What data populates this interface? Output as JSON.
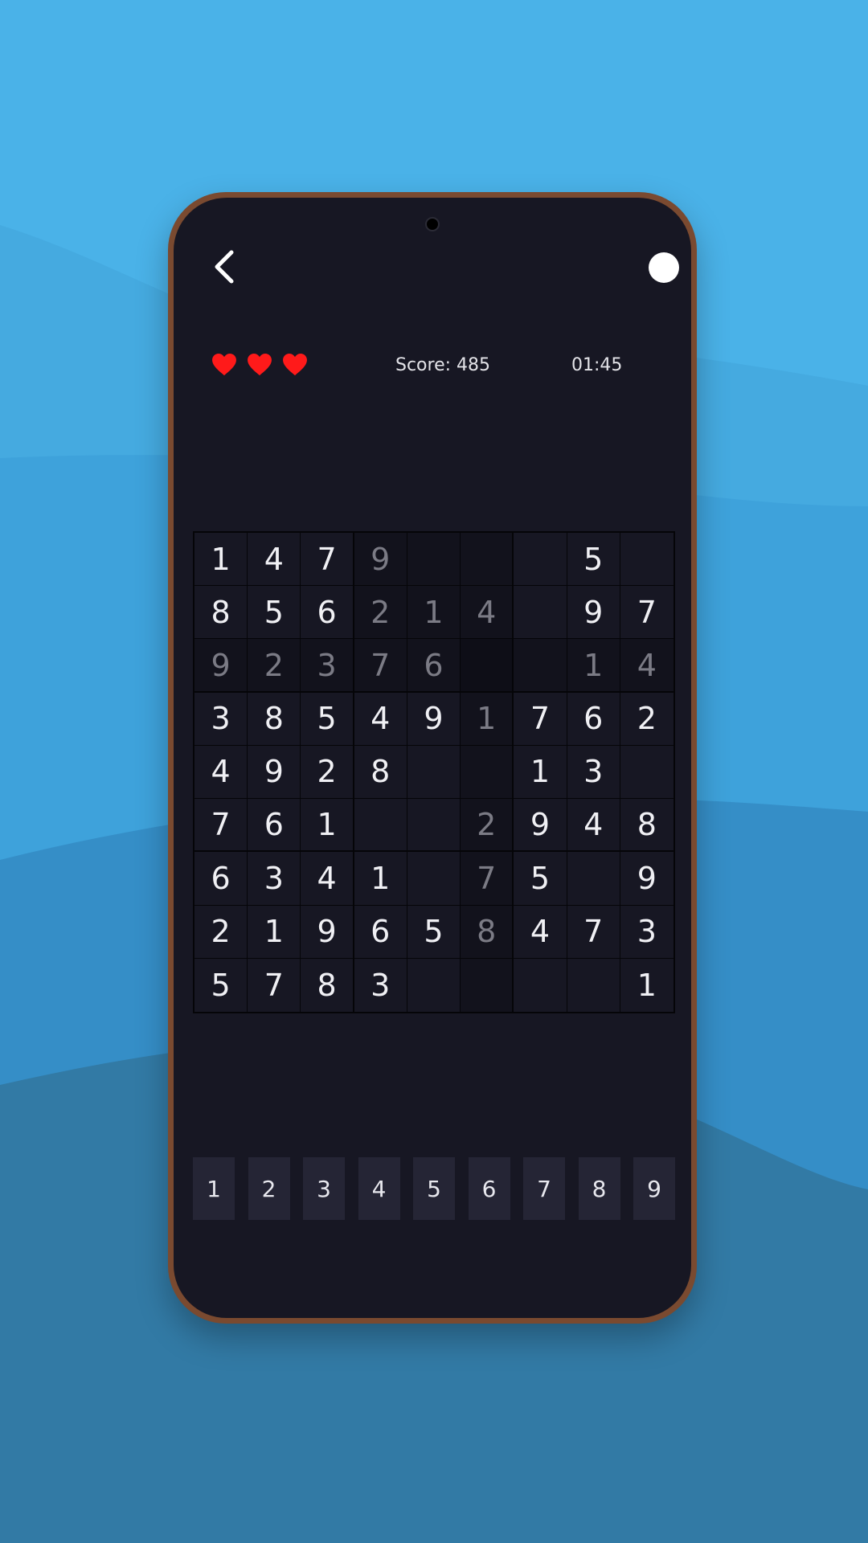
{
  "colors": {
    "background_sky": "#4ab2e8",
    "phone_frame": "#7a4a30",
    "screen_bg": "#171723",
    "heart": "#ff1a1a",
    "numpad_bg": "#252535"
  },
  "header": {
    "back_icon": "chevron-left-icon",
    "toggle_icon": "white-circle-toggle"
  },
  "status": {
    "lives": 3,
    "score_text": "Score: 485",
    "timer_text": "01:45"
  },
  "board": {
    "rows": [
      [
        "1",
        "4",
        "7",
        "9",
        "",
        "",
        "",
        "5",
        ""
      ],
      [
        "8",
        "5",
        "6",
        "2",
        "1",
        "4",
        "",
        "9",
        "7"
      ],
      [
        "9",
        "2",
        "3",
        "7",
        "6",
        "",
        "",
        "1",
        "4"
      ],
      [
        "3",
        "8",
        "5",
        "4",
        "9",
        "1",
        "7",
        "6",
        "2"
      ],
      [
        "4",
        "9",
        "2",
        "8",
        "",
        "",
        "1",
        "3",
        ""
      ],
      [
        "7",
        "6",
        "1",
        "",
        "",
        "2",
        "9",
        "4",
        "8"
      ],
      [
        "6",
        "3",
        "4",
        "1",
        "",
        "7",
        "5",
        "",
        "9"
      ],
      [
        "2",
        "1",
        "9",
        "6",
        "5",
        "8",
        "4",
        "7",
        "3"
      ],
      [
        "5",
        "7",
        "8",
        "3",
        "",
        "",
        "",
        "",
        "1"
      ]
    ],
    "user_entered": [
      [
        false,
        false,
        false,
        true,
        false,
        false,
        false,
        false,
        false
      ],
      [
        false,
        false,
        false,
        true,
        true,
        true,
        false,
        false,
        false
      ],
      [
        true,
        true,
        true,
        true,
        true,
        false,
        false,
        true,
        true
      ],
      [
        false,
        false,
        false,
        false,
        false,
        true,
        false,
        false,
        false
      ],
      [
        false,
        false,
        false,
        false,
        false,
        false,
        false,
        false,
        false
      ],
      [
        false,
        false,
        false,
        false,
        false,
        true,
        false,
        false,
        false
      ],
      [
        false,
        false,
        false,
        false,
        false,
        true,
        false,
        false,
        false
      ],
      [
        false,
        false,
        false,
        false,
        false,
        true,
        false,
        false,
        false
      ],
      [
        false,
        false,
        false,
        false,
        false,
        false,
        false,
        false,
        false
      ]
    ],
    "highlighted_row": 2,
    "highlighted_col": 5
  },
  "numpad": [
    "1",
    "2",
    "3",
    "4",
    "5",
    "6",
    "7",
    "8",
    "9"
  ]
}
